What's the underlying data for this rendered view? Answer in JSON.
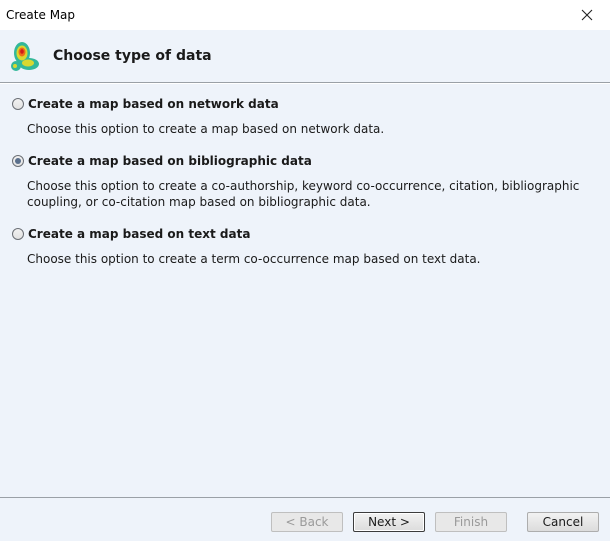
{
  "window": {
    "title": "Create Map",
    "close_icon": "close-icon"
  },
  "header": {
    "title": "Choose type of data",
    "icon": "density-map-icon"
  },
  "options": [
    {
      "label": "Create a map based on network data",
      "description": "Choose this option to create a map based on network data.",
      "selected": false
    },
    {
      "label": "Create a map based on bibliographic data",
      "description": "Choose this option to create a co-authorship, keyword co-occurrence, citation, bibliographic coupling, or co-citation map based on bibliographic data.",
      "selected": true
    },
    {
      "label": "Create a map based on text data",
      "description": "Choose this option to create a term co-occurrence map based on text data.",
      "selected": false
    }
  ],
  "buttons": {
    "back": "< Back",
    "next": "Next >",
    "finish": "Finish",
    "cancel": "Cancel"
  },
  "colors": {
    "panel_background": "#eef3fa",
    "selected_radio": "#5a6f8c"
  }
}
